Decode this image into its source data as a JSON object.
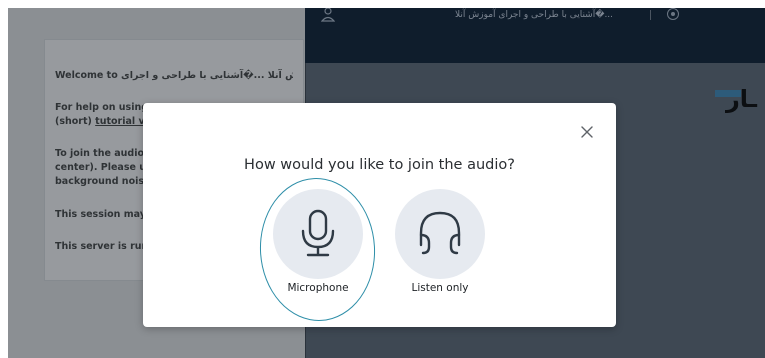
{
  "chat": {
    "welcome": "Welcome to آموزش آنلا ...�آشنایی با طراحی و اجرای!",
    "help_line1": "For help on using",
    "help_line2_prefix": "(short) ",
    "help_link": "tutorial vid",
    "audio_line1": "To join the audio b",
    "audio_line2": "center). Please use",
    "audio_line3": "background noise",
    "session": "This session may b",
    "server": "This server is runn"
  },
  "nav": {
    "user_icon": "user-icon",
    "meeting_title": "...�آشنایی با طراحی و اجرای آموزش آنلا",
    "record_icon": "record-icon"
  },
  "presentation": {
    "title_fragment": "ـار"
  },
  "modal": {
    "title": "How would you like to join the audio?",
    "close_icon": "close-icon",
    "options": [
      {
        "label": "Microphone",
        "icon": "microphone-icon"
      },
      {
        "label": "Listen only",
        "icon": "headphones-icon"
      }
    ],
    "highlight_color": "#2d8ea8"
  },
  "colors": {
    "overlay_panel": "#8b8f93",
    "nav_bg": "#0f1d2c",
    "main_bg": "#3e4853",
    "option_bg": "#e6eaf0"
  }
}
